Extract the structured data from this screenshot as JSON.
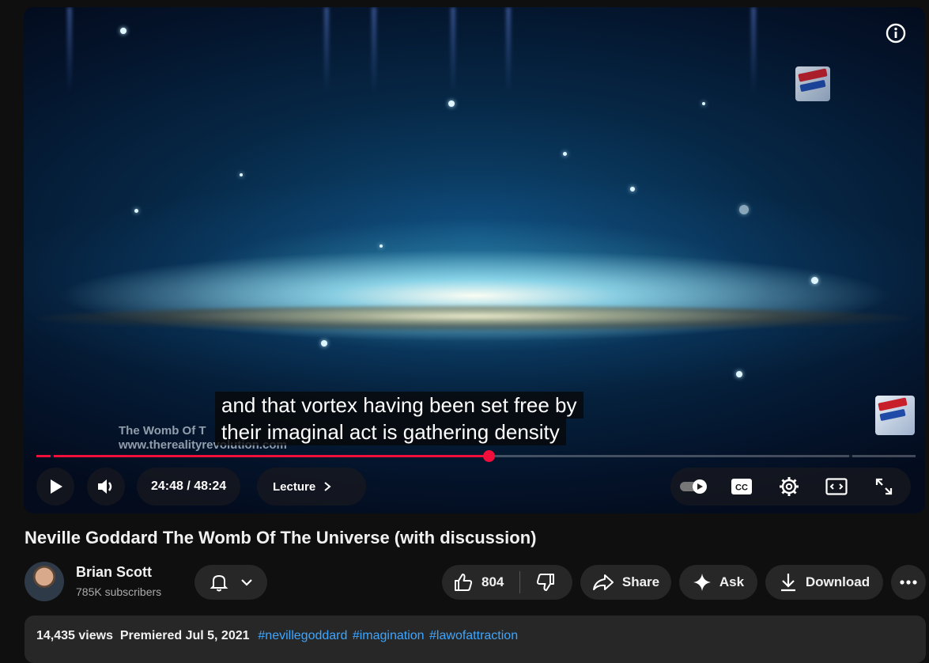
{
  "video": {
    "caption_line1": "and that vortex having been set free by",
    "caption_line2": "their imaginal act is gathering density",
    "watermark_line1": "The Womb Of T",
    "watermark_line2": "www.therealityrevolution.com",
    "progress_fraction": 0.514,
    "current_time": "24:48",
    "time_separator": " / ",
    "duration": "48:24",
    "chapter_label": "Lecture",
    "cc_label": "CC"
  },
  "title": "Neville Goddard The Womb Of The Universe (with discussion)",
  "channel": {
    "name": "Brian Scott",
    "subscribers": "785K subscribers"
  },
  "actions": {
    "like_count": "804",
    "share_label": "Share",
    "ask_label": "Ask",
    "download_label": "Download"
  },
  "description": {
    "views": "14,435 views",
    "premiered": "Premiered Jul 5, 2021",
    "tags": [
      "#nevillegoddard",
      "#imagination",
      "#lawofattraction"
    ]
  },
  "colors": {
    "accent_red": "#f00e3a",
    "link_blue": "#3ea6ff",
    "background": "#0f0f0f",
    "pill": "#272727"
  },
  "icons": [
    "info-icon",
    "play-icon",
    "volume-icon",
    "chevron-right-icon",
    "autoplay-toggle-icon",
    "cc-icon",
    "settings-gear-icon",
    "miniplayer-icon",
    "fullscreen-icon",
    "bell-icon",
    "chevron-down-icon",
    "thumbs-up-icon",
    "thumbs-down-icon",
    "share-arrow-icon",
    "sparkle-icon",
    "download-icon",
    "more-dots-icon"
  ]
}
